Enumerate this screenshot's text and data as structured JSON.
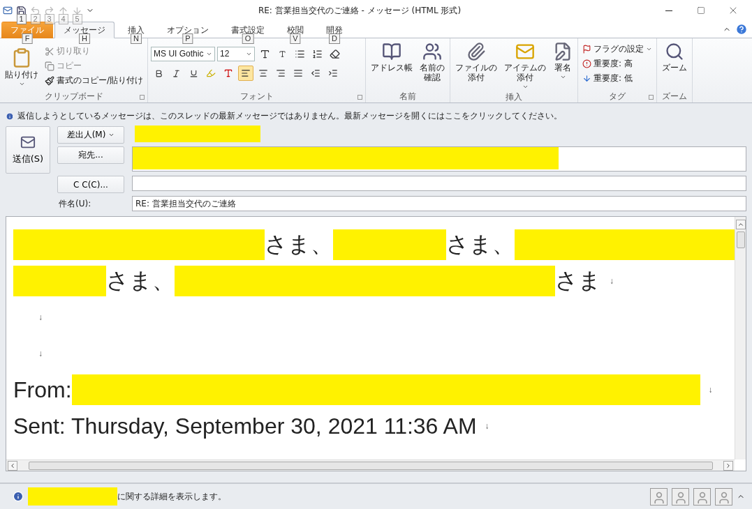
{
  "window": {
    "title": "RE: 営業担当交代のご連絡 - メッセージ (HTML 形式)"
  },
  "quick_access": [
    {
      "keytip": "1",
      "disabled": false
    },
    {
      "keytip": "2",
      "disabled": true
    },
    {
      "keytip": "3",
      "disabled": true
    },
    {
      "keytip": "4",
      "disabled": true
    },
    {
      "keytip": "5",
      "disabled": true
    }
  ],
  "tabs": [
    {
      "label": "ファイル",
      "keytip": "F",
      "kind": "file",
      "selected": false
    },
    {
      "label": "メッセージ",
      "keytip": "H",
      "kind": "tab",
      "selected": true
    },
    {
      "label": "挿入",
      "keytip": "N",
      "kind": "tab",
      "selected": false
    },
    {
      "label": "オプション",
      "keytip": "P",
      "kind": "tab",
      "selected": false
    },
    {
      "label": "書式設定",
      "keytip": "O",
      "kind": "tab",
      "selected": false
    },
    {
      "label": "校閲",
      "keytip": "V",
      "kind": "tab",
      "selected": false
    },
    {
      "label": "開発",
      "keytip": "D",
      "kind": "tab",
      "selected": false
    }
  ],
  "ribbon": {
    "clipboard": {
      "label": "クリップボード",
      "paste": "貼り付け",
      "items": [
        {
          "label": "切り取り",
          "disabled": true
        },
        {
          "label": "コピー",
          "disabled": true
        },
        {
          "label": "書式のコピー/貼り付け",
          "disabled": false
        }
      ]
    },
    "font": {
      "label": "フォント",
      "font_name": "MS UI Gothic",
      "font_size": "12"
    },
    "names": {
      "label": "名前",
      "items": [
        {
          "label": "アドレス帳"
        },
        {
          "label": "名前の確認"
        }
      ]
    },
    "insert": {
      "label": "挿入",
      "items": [
        {
          "label": "ファイルの添付",
          "dropdown": false
        },
        {
          "label": "アイテムの添付",
          "dropdown": true
        },
        {
          "label": "署名",
          "dropdown": true
        }
      ]
    },
    "tags": {
      "label": "タグ",
      "items": [
        {
          "label": "フラグの設定",
          "dropdown": true
        },
        {
          "label": "重要度: 高",
          "dropdown": false
        },
        {
          "label": "重要度: 低",
          "dropdown": false
        }
      ]
    },
    "zoom": {
      "label": "ズーム",
      "button": "ズーム"
    }
  },
  "info_bar": "返信しようとしているメッセージは、このスレッドの最新メッセージではありません。最新メッセージを開くにはここをクリックしてください。",
  "header": {
    "send": "送信(S)",
    "from_button": "差出人(M)",
    "to_button": "宛先...",
    "cc_button": "C C(C)...",
    "subject_label": "件名(U):",
    "subject": "RE: 営業担当交代のご連絡"
  },
  "body": [
    [
      {
        "kind": "redacted"
      },
      {
        "kind": "text",
        "text": "さま、"
      },
      {
        "kind": "redacted"
      },
      {
        "kind": "text",
        "text": "さま、"
      },
      {
        "kind": "redacted"
      }
    ],
    [
      {
        "kind": "redacted"
      },
      {
        "kind": "text",
        "text": "さま、"
      },
      {
        "kind": "redacted"
      },
      {
        "kind": "text",
        "text": "さま"
      },
      {
        "kind": "mark",
        "text": "↓"
      }
    ],
    [
      {
        "kind": "mark",
        "text": "↓"
      }
    ],
    [
      {
        "kind": "mark",
        "text": "↓"
      }
    ],
    [
      {
        "kind": "text",
        "text": "From: "
      },
      {
        "kind": "redacted"
      },
      {
        "kind": "mark",
        "text": "↓"
      }
    ],
    [
      {
        "kind": "text",
        "text": "Sent: Thursday, September 30, 2021 11:36 AM"
      },
      {
        "kind": "mark",
        "text": "↓"
      }
    ]
  ],
  "status_bar": {
    "text": "に関する詳細を表示します。"
  }
}
